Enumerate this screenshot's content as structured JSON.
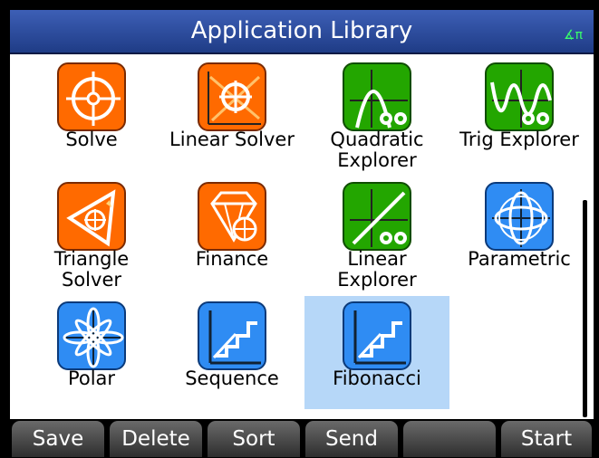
{
  "window": {
    "title": "Application Library",
    "angle_indicator": "∡π"
  },
  "apps": [
    {
      "label": "Solve",
      "color": "#ff6a00",
      "icon": "target-icon"
    },
    {
      "label": "Linear Solver",
      "color": "#ff6a00",
      "icon": "linear-target-icon"
    },
    {
      "label": "Quadratic Explorer",
      "label_line1": "Quadratic",
      "label_line2": "Explorer",
      "color": "#23a600",
      "icon": "parabola-binoculars-icon"
    },
    {
      "label": "Trig Explorer",
      "color": "#23a600",
      "icon": "wave-binoculars-icon"
    },
    {
      "label": "Triangle Solver",
      "label_line1": "Triangle",
      "label_line2": "Solver",
      "color": "#ff6a00",
      "icon": "triangle-target-icon"
    },
    {
      "label": "Finance",
      "color": "#ff6a00",
      "icon": "diamond-icon"
    },
    {
      "label": "Linear Explorer",
      "label_line1": "Linear",
      "label_line2": "Explorer",
      "color": "#23a600",
      "icon": "line-binoculars-icon"
    },
    {
      "label": "Parametric",
      "color": "#2f8cf3",
      "icon": "parametric-curve-icon"
    },
    {
      "label": "Polar",
      "color": "#2f8cf3",
      "icon": "polar-rose-icon"
    },
    {
      "label": "Sequence",
      "color": "#2f8cf3",
      "icon": "staircase-icon"
    },
    {
      "label": "Fibonacci",
      "color": "#2f8cf3",
      "icon": "staircase-icon",
      "selected": true
    }
  ],
  "menu": {
    "save": "Save",
    "delete": "Delete",
    "sort": "Sort",
    "send": "Send",
    "blank": "",
    "start": "Start"
  },
  "colors": {
    "title_bar": "#2f4fa0",
    "selection": "#b6d7f8",
    "orange": "#ff6a00",
    "green": "#23a600",
    "blue": "#2f8cf3"
  }
}
